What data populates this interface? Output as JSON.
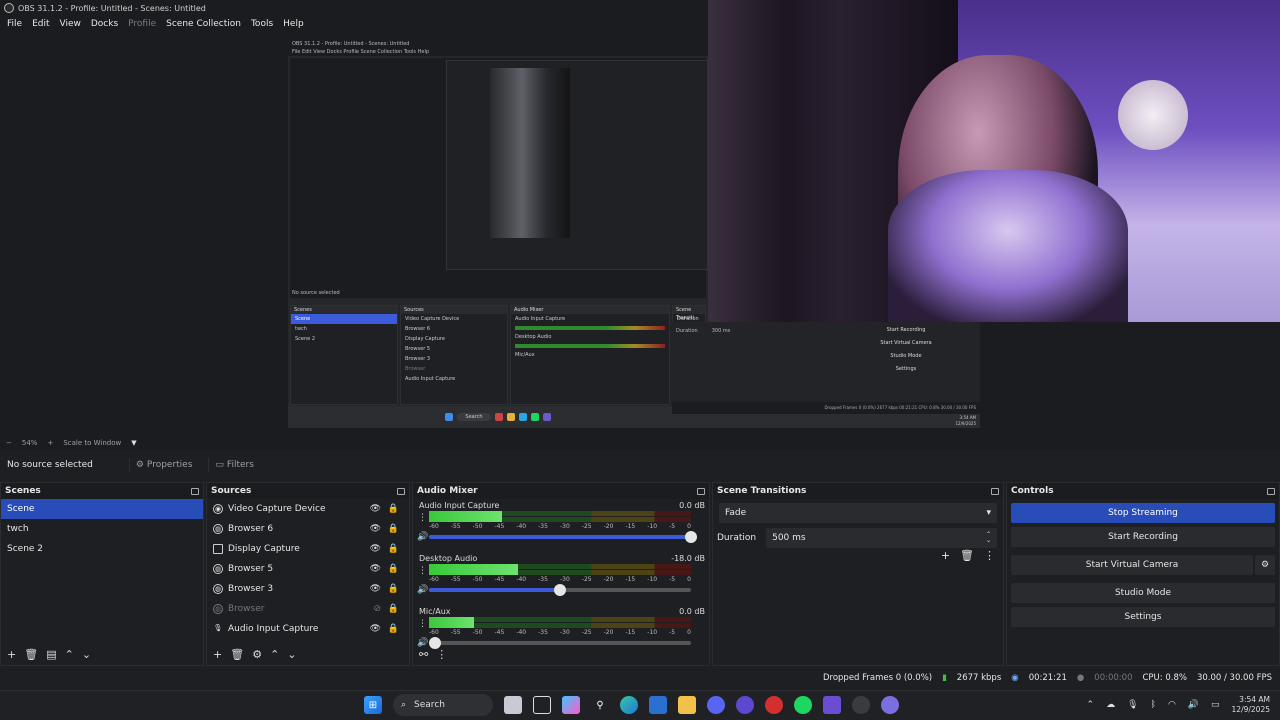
{
  "window": {
    "title": "OBS 31.1.2 - Profile: Untitled - Scenes: Untitled"
  },
  "menu": [
    "File",
    "Edit",
    "View",
    "Docks",
    "Profile",
    "Scene Collection",
    "Tools",
    "Help"
  ],
  "preview": {
    "nested_title": "OBS 31.1.2 - Profile: Untitled - Scenes: Untitled",
    "nested_menu": "File  Edit  View  Docks  Profile  Scene Collection  Tools  Help",
    "nested_status": "No source selected",
    "nested_scenes": [
      "Scene",
      "twch",
      "Scene 2"
    ],
    "nested_sources": [
      "Video Capture Device",
      "Browser 6",
      "Display Capture",
      "Browser 5",
      "Browser 3",
      "Browser",
      "Audio Input Capture"
    ],
    "nested_mixer": [
      "Audio Input Capture",
      "Desktop Audio",
      "Mic/Aux"
    ],
    "nested_controls": [
      "Start Recording",
      "Start Virtual Camera",
      "Studio Mode",
      "Settings"
    ],
    "nested_duration": "Duration",
    "nested_duration_value": "300 ms",
    "nested_panels": {
      "scenes": "Scenes",
      "sources": "Sources",
      "mixer": "Audio Mixer",
      "transitions": "Scene Transiti"
    },
    "nested_statusbar": "Dropped Frames 0 (0.0%)  2677 kbps  00:21:21  CPU: 0.8%  30.00 / 30.00 FPS",
    "nested_search": "Search",
    "nested_clock": "3:54 AM",
    "nested_date": "12/9/2025"
  },
  "canvas": {
    "zoom": "54%",
    "scale_mode": "Scale to Window"
  },
  "source_toolbar": {
    "status": "No source selected",
    "properties": "Properties",
    "filters": "Filters"
  },
  "scenes": {
    "title": "Scenes",
    "items": [
      "Scene",
      "twch",
      "Scene 2"
    ],
    "selected": "Scene"
  },
  "sources": {
    "title": "Sources",
    "items": [
      {
        "name": "Video Capture Device",
        "icon": "camera-icon",
        "visible": true
      },
      {
        "name": "Browser 6",
        "icon": "globe-icon",
        "visible": true
      },
      {
        "name": "Display Capture",
        "icon": "monitor-icon",
        "visible": true
      },
      {
        "name": "Browser 5",
        "icon": "globe-icon",
        "visible": true
      },
      {
        "name": "Browser 3",
        "icon": "globe-icon",
        "visible": true
      },
      {
        "name": "Browser",
        "icon": "globe-icon",
        "visible": false
      },
      {
        "name": "Audio Input Capture",
        "icon": "microphone-icon",
        "visible": true
      }
    ]
  },
  "mixer": {
    "title": "Audio Mixer",
    "scale": [
      "-60",
      "-55",
      "-50",
      "-45",
      "-40",
      "-35",
      "-30",
      "-25",
      "-20",
      "-15",
      "-10",
      "-5",
      "0"
    ],
    "channels": [
      {
        "name": "Audio Input Capture",
        "db": "0.0 dB",
        "level": 0.28,
        "volume": 1.0
      },
      {
        "name": "Desktop Audio",
        "db": "-18.0 dB",
        "level": 0.34,
        "volume": 0.5
      },
      {
        "name": "Mic/Aux",
        "db": "0.0 dB",
        "level": 0.17,
        "volume": 0.0
      }
    ]
  },
  "transitions": {
    "title": "Scene Transitions",
    "selected": "Fade",
    "duration_label": "Duration",
    "duration_value": "500 ms"
  },
  "controls": {
    "title": "Controls",
    "buttons": [
      "Stop Streaming",
      "Start Recording",
      "Start Virtual Camera",
      "Studio Mode",
      "Settings"
    ]
  },
  "status": {
    "dropped": "Dropped Frames 0 (0.0%)",
    "bitrate": "2677 kbps",
    "stream_time": "00:21:21",
    "record_time": "00:00:00",
    "cpu": "CPU: 0.8%",
    "fps": "30.00 / 30.00 FPS"
  },
  "taskbar": {
    "search": "Search",
    "time": "3:54 AM",
    "date": "12/9/2025"
  },
  "colors": {
    "accent": "#284cb8",
    "meter_green": "#39c939",
    "background": "#1e1f22"
  }
}
